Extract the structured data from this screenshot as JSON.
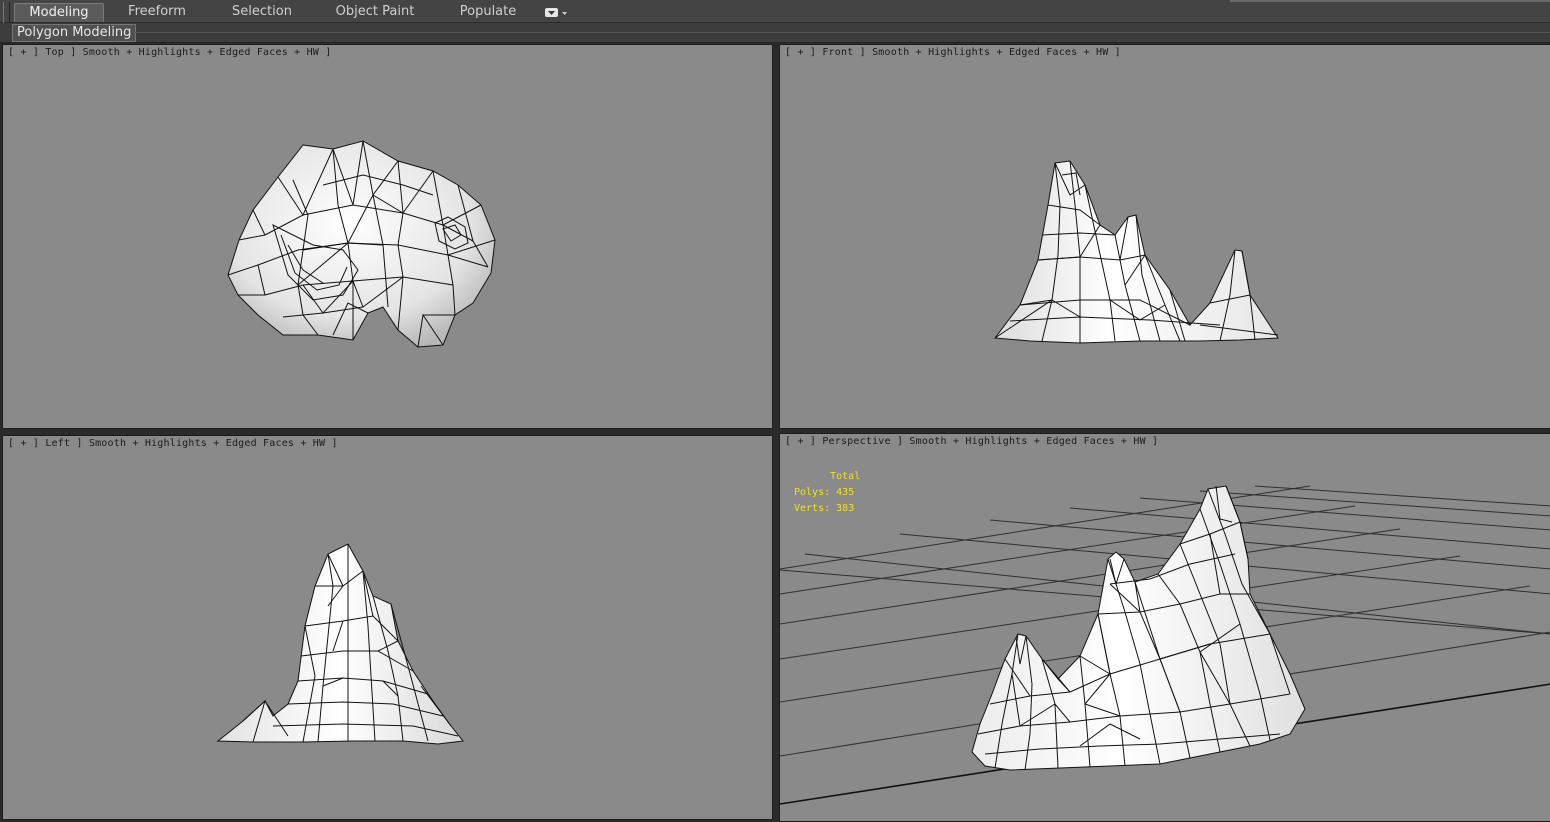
{
  "ribbon": {
    "tabs": [
      {
        "label": "Modeling",
        "active": true
      },
      {
        "label": "Freeform",
        "active": false
      },
      {
        "label": "Selection",
        "active": false
      },
      {
        "label": "Object Paint",
        "active": false
      },
      {
        "label": "Populate",
        "active": false
      }
    ],
    "dropdown_icon": "dropdown-arrow-icon"
  },
  "subribbon": {
    "panel_label": "Polygon Modeling"
  },
  "viewports": {
    "top": {
      "label": "[ + ] Top ] Smooth + Highlights + Edged Faces + HW ]"
    },
    "front": {
      "label": "[ + ] Front ] Smooth + Highlights + Edged Faces + HW ]"
    },
    "left": {
      "label": "[ + ] Left ] Smooth + Highlights + Edged Faces + HW ]"
    },
    "perspective": {
      "label": "[ + ] Perspective ] Smooth + Highlights + Edged Faces + HW ]",
      "stats": {
        "header": "Total",
        "polys_label": "Polys:",
        "polys": "435",
        "verts_label": "Verts:",
        "verts": "383"
      }
    }
  },
  "colors": {
    "viewport_bg": "#8a8a8a",
    "mesh_fill": "#f2f2f2",
    "mesh_edge": "#111111",
    "stats_text": "#f4e21a",
    "grid_line": "#2f2f2f"
  }
}
